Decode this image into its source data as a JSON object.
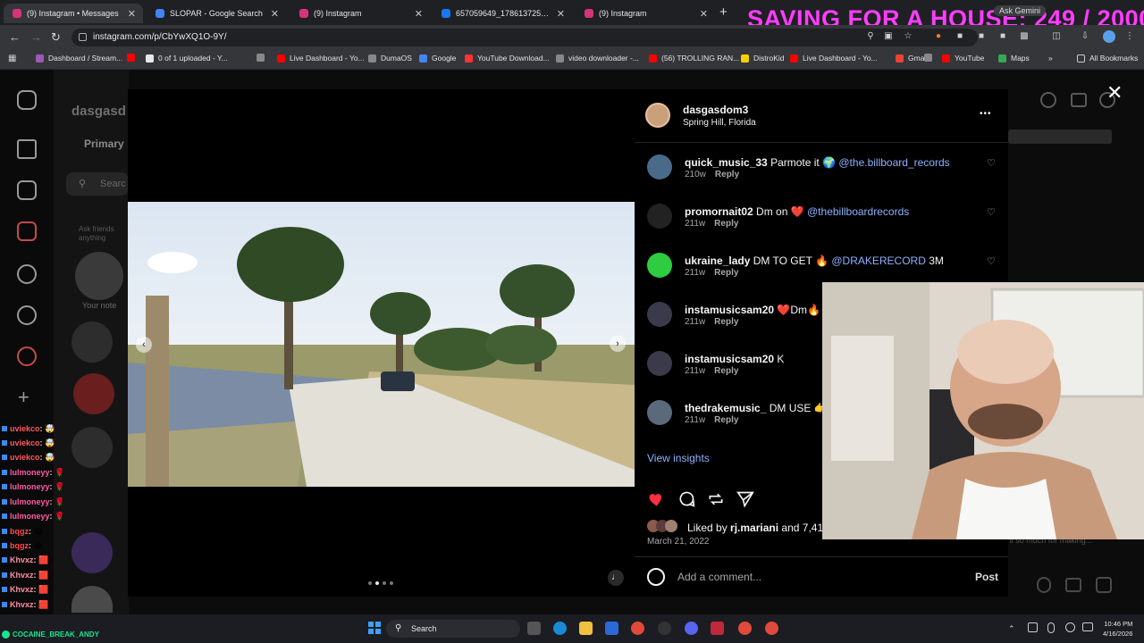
{
  "overlay_text": "SAVING FOR A HOUSE: 249 / 20000",
  "browser": {
    "tabs": [
      {
        "label": "(9) Instagram • Messages",
        "favicon": "instagram-icon",
        "color": "#d6337a"
      },
      {
        "label": "SLOPAR - Google Search",
        "favicon": "google-icon",
        "color": "#4285f4"
      },
      {
        "label": "(9) Instagram",
        "favicon": "instagram-icon",
        "color": "#d6337a"
      },
      {
        "label": "657059649_1786137252965531",
        "favicon": "facebook-icon",
        "color": "#1877f2"
      },
      {
        "label": "(9) Instagram",
        "favicon": "instagram-icon",
        "color": "#d6337a"
      }
    ],
    "new_tab": "+",
    "ask_gemini": "Ask Gemini",
    "url": "instagram.com/p/CbYwXQ1O-9Y/",
    "bookmarks": [
      {
        "label": "Dashboard / Stream...",
        "color": "#9b59b6"
      },
      {
        "label": "",
        "color": "#ff0000"
      },
      {
        "label": "0 of 1 uploaded - Y...",
        "color": "#e8e8e8"
      },
      {
        "label": "",
        "color": "#888888"
      },
      {
        "label": "Live Dashboard - Yo...",
        "color": "#ff0000"
      },
      {
        "label": "DumaOS",
        "color": "#888888"
      },
      {
        "label": "Google",
        "color": "#4285f4"
      },
      {
        "label": "YouTube Download...",
        "color": "#ff3333"
      },
      {
        "label": "video downloader -...",
        "color": "#888888"
      },
      {
        "label": "(56) TROLLING RAN...",
        "color": "#ff0000"
      },
      {
        "label": "DistroKid",
        "color": "#f5d000"
      },
      {
        "label": "Live Dashboard - Yo...",
        "color": "#ff0000"
      },
      {
        "label": "Gmail",
        "color": "#ea4335"
      },
      {
        "label": "",
        "color": "#888888"
      },
      {
        "label": "YouTube",
        "color": "#ff0000"
      },
      {
        "label": "Maps",
        "color": "#34a853"
      }
    ],
    "all_bookmarks": "All Bookmarks"
  },
  "instagram_bg": {
    "username": "dasgasd",
    "primary": "Primary",
    "search": "Searc",
    "ask_friends": "Ask friends anything",
    "your_note": "Your note",
    "preview": "'ll so much for making..."
  },
  "chat": [
    {
      "user": "uviekco",
      "color": "#ff5a5a",
      "msg": "🤯"
    },
    {
      "user": "uviekco",
      "color": "#ff5a5a",
      "msg": "🤯"
    },
    {
      "user": "uviekco",
      "color": "#ff5a5a",
      "msg": "🤯"
    },
    {
      "user": "lulmoneyy",
      "color": "#ff5aa6",
      "msg": "🌹"
    },
    {
      "user": "lulmoneyy",
      "color": "#ff5aa6",
      "msg": "🌹"
    },
    {
      "user": "lulmoneyy",
      "color": "#ff5aa6",
      "msg": "🌹"
    },
    {
      "user": "lulmoneyy",
      "color": "#ff5aa6",
      "msg": "🌹"
    },
    {
      "user": "bqgz",
      "color": "#ff4a4a",
      "msg": "😂"
    },
    {
      "user": "bqgz",
      "color": "#ff4a4a",
      "msg": "😂"
    },
    {
      "user": "Khvxz",
      "color": "#ff8fa0",
      "msg": "🟥"
    },
    {
      "user": "Khvxz",
      "color": "#ff8fa0",
      "msg": "🟥"
    },
    {
      "user": "Khvxz",
      "color": "#ff8fa0",
      "msg": "🟥"
    },
    {
      "user": "Khvxz",
      "color": "#ff8fa0",
      "msg": "🟥"
    },
    {
      "user": "Khvxz",
      "color": "#ff8fa0",
      "msg": "🟥"
    }
  ],
  "chat_footer_user": "COCAINE_BREAK_ANDY",
  "post": {
    "username": "dasgasdom3",
    "location": "Spring Hill, Florida",
    "more": "•••",
    "comments": [
      {
        "user": "quick_music_33",
        "text": "Parmote it 🌍",
        "mention": "@the.billboard_records",
        "time": "210w",
        "reply": "Reply",
        "avatar_color": "#4a6a8a"
      },
      {
        "user": "promornait02",
        "text": "Dm on ❤️",
        "mention": "@thebillboardrecords",
        "time": "211w",
        "reply": "Reply",
        "avatar_color": "#222222"
      },
      {
        "user": "ukraine_lady",
        "text": "DM TO GET 🔥",
        "mention": "@DRAKERECORD",
        "suffix": "3M",
        "time": "211w",
        "reply": "Reply",
        "avatar_color": "#2ecc40"
      },
      {
        "user": "instamusicsam20",
        "text": "❤️Dm🔥",
        "mention": "@",
        "time": "211w",
        "reply": "Reply",
        "avatar_color": "#3a3a4a"
      },
      {
        "user": "instamusicsam20",
        "text": "K",
        "mention": "",
        "time": "211w",
        "reply": "Reply",
        "avatar_color": "#3a3a4a"
      },
      {
        "user": "thedrakemusic_",
        "text": "DM USE 👉",
        "mention": "@",
        "time": "211w",
        "reply": "Reply",
        "avatar_color": "#5a6a7a"
      }
    ],
    "view_insights": "View insights",
    "liked_by_prefix": "Liked by",
    "liked_by_user": "rj.mariani",
    "liked_by_suffix": "and 7,410",
    "date": "March 21, 2022",
    "add_comment": "Add a comment...",
    "post_button": "Post"
  },
  "taskbar": {
    "search": "Search",
    "time": "10:46 PM",
    "date": "4/16/2026"
  }
}
